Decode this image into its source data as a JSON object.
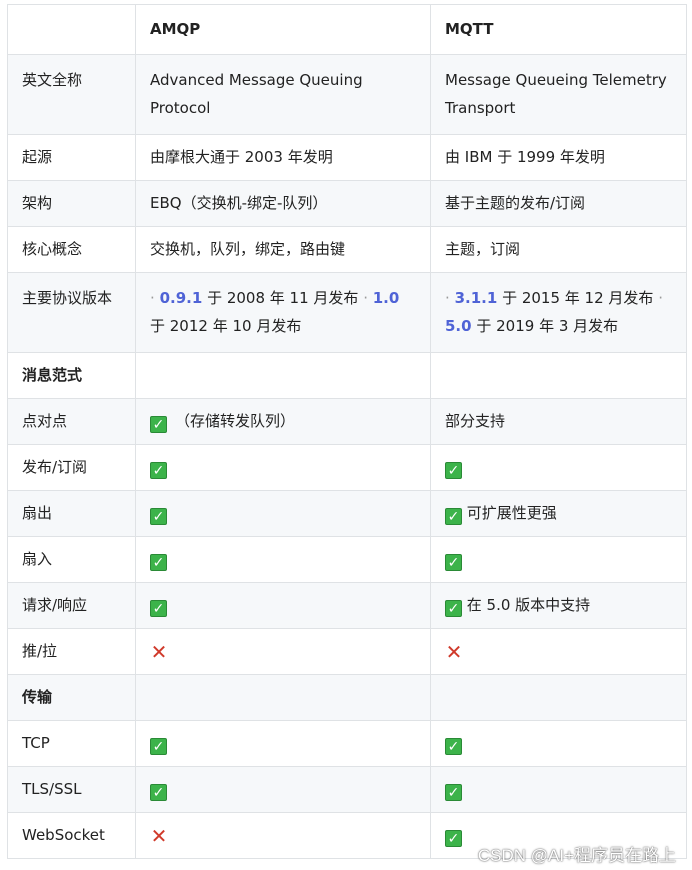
{
  "header": {
    "corner": "",
    "col_amqp": "AMQP",
    "col_mqtt": "MQTT"
  },
  "rows": {
    "fullname": {
      "label": "英文全称",
      "amqp": "Advanced Message Queuing Protocol",
      "mqtt": "Message Queueing Telemetry Transport"
    },
    "origin": {
      "label": "起源",
      "amqp": "由摩根大通于 2003 年发明",
      "mqtt": "由 IBM 于 1999 年发明"
    },
    "architecture": {
      "label": "架构",
      "amqp": "EBQ（交换机-绑定-队列）",
      "mqtt": "基于主题的发布/订阅"
    },
    "core": {
      "label": "核心概念",
      "amqp": "交换机，队列，绑定，路由键",
      "mqtt": "主题，订阅"
    },
    "versions": {
      "label": "主要协议版本",
      "amqp": {
        "bullet": "·",
        "v1": "0.9.1",
        "v1_text": "于 2008 年 11 月发布",
        "v2": "1.0",
        "v2_text": "于 2012 年 10 月发布"
      },
      "mqtt": {
        "bullet": "·",
        "v1": "3.1.1",
        "v1_text": "于 2015 年 12 月发布",
        "v2": "5.0",
        "v2_text": "于 2019 年 3 月发布"
      }
    },
    "msg_section": {
      "label": "消息范式"
    },
    "p2p": {
      "label": "点对点",
      "amqp_note": "（存储转发队列）",
      "mqtt": "部分支持"
    },
    "pubsub": {
      "label": "发布/订阅"
    },
    "fanout": {
      "label": "扇出",
      "mqtt_note": "可扩展性更强"
    },
    "fanin": {
      "label": "扇入"
    },
    "reqresp": {
      "label": "请求/响应",
      "mqtt_note": "在 5.0 版本中支持"
    },
    "pushpull": {
      "label": "推/拉"
    },
    "transport_section": {
      "label": "传输"
    },
    "tcp": {
      "label": "TCP"
    },
    "tls": {
      "label": "TLS/SSL"
    },
    "websocket": {
      "label": "WebSocket"
    }
  },
  "icons": {
    "check": "check-mark-icon",
    "cross": "cross-mark-icon"
  },
  "colors": {
    "check": "#3cb34a",
    "cross": "#d03a2b",
    "version_link": "#4f63d6",
    "border": "#dfe2e5",
    "row_alt": "#f6f8fa"
  },
  "watermark": "CSDN @AI+程序员在路上"
}
